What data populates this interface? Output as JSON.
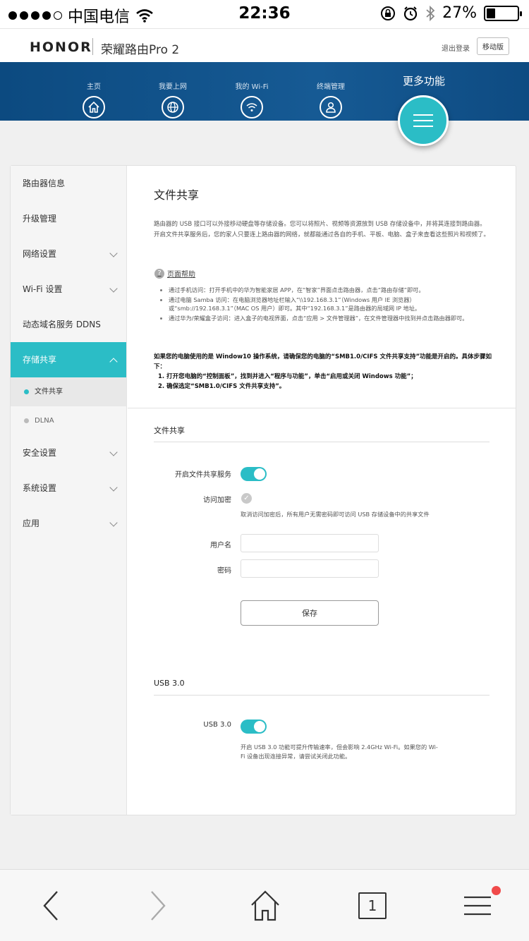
{
  "status_bar": {
    "carrier": "中国电信",
    "time": "22:36",
    "battery": "27%"
  },
  "header": {
    "brand": "HONOR",
    "product": "荣耀路由Pro 2",
    "logout": "退出登录",
    "mobile_version": "移动版"
  },
  "nav": {
    "items": [
      {
        "label": "主页",
        "icon": "home-icon"
      },
      {
        "label": "我要上网",
        "icon": "globe-icon"
      },
      {
        "label": "我的 Wi-Fi",
        "icon": "wifi-icon"
      },
      {
        "label": "终端管理",
        "icon": "user-icon"
      }
    ],
    "more": "更多功能"
  },
  "sidebar": {
    "items": [
      {
        "label": "路由器信息"
      },
      {
        "label": "升级管理"
      },
      {
        "label": "网络设置"
      },
      {
        "label": "Wi-Fi 设置"
      },
      {
        "label": "动态域名服务 DDNS"
      },
      {
        "label": "存储共享"
      },
      {
        "label": "安全设置"
      },
      {
        "label": "系统设置"
      },
      {
        "label": "应用"
      }
    ],
    "sub_items": [
      {
        "label": "文件共享"
      },
      {
        "label": "DLNA"
      }
    ]
  },
  "main": {
    "title": "文件共享",
    "intro": "路由器的 USB 接口可以外接移动硬盘等存储设备。您可以将照片、视频等资源放到 USB 存储设备中，并将其连接到路由器。开启文件共享服务后，您的家人只要连上路由器的网络，就都能通过各自的手机、平板、电脑、盒子来查看这些照片和视频了。",
    "help_title": "页面帮助",
    "help_items": [
      "通过手机访问：打开手机中的华为智能家居 APP，在“智家”界面点击路由器，点击“路由存储”即可。",
      "通过电脑 Samba 访问：在电脑浏览器地址栏输入“\\\\192.168.3.1”（Windows 用户 IE 浏览器）或“smb://192.168.3.1”（MAC OS 用户）即可。其中“192.168.3.1”是路由器的局域网 IP 地址。",
      "通过华为/荣耀盒子访问：进入盒子的电视界面，点击“应用 > 文件管理器”，在文件管理器中找到并点击路由器即可。"
    ],
    "note": "如果您的电脑使用的是 Window10 操作系统，请确保您的电脑的“SMB1.0/CIFS 文件共享支持”功能是开启的。具体步骤如下：",
    "steps": [
      "1. 打开您电脑的“控制面板”，找到并进入“程序与功能”，单击“启用或关闭 Windows 功能”；",
      "2. 确保选定“SMB1.0/CIFS 文件共享支持”。"
    ],
    "file_share": {
      "section_title": "文件共享",
      "enable_label": "开启文件共享服务",
      "enabled": true,
      "encrypt_label": "访问加密",
      "encrypt_hint": "取消访问加密后，所有用户无需密码即可访问 USB 存储设备中的共享文件",
      "username_label": "用户名",
      "username_value": "",
      "password_label": "密码",
      "password_value": "",
      "save_label": "保存"
    },
    "usb": {
      "section_title": "USB 3.0",
      "toggle_label": "USB 3.0",
      "enabled": true,
      "hint": "开启 USB 3.0 功能可提升传输速率，但会影响 2.4GHz Wi-Fi。如果您的 Wi-Fi 设备出现连接异常，请尝试关闭此功能。"
    }
  },
  "browser_bar": {
    "tab_count": "1"
  },
  "colors": {
    "accent": "#2bbdc6",
    "nav_bg": "#0f4f88",
    "badge": "#f04a4a"
  }
}
